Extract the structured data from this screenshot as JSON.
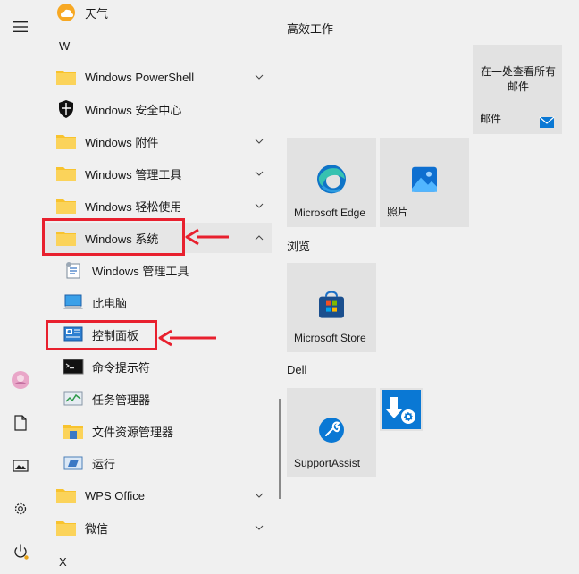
{
  "rail": {
    "menu_icon": "hamburger-menu-icon",
    "avatar": "user-avatar",
    "documents_icon": "document-icon",
    "pictures_icon": "pictures-icon",
    "settings_icon": "gear-icon",
    "power_icon": "power-icon"
  },
  "apps": {
    "weather": "天气",
    "letter_w": "W",
    "powershell": "Windows PowerShell",
    "security": "Windows 安全中心",
    "accessories": "Windows 附件",
    "admin_tools": "Windows 管理工具",
    "ease_access": "Windows 轻松使用",
    "system": "Windows 系统",
    "sys_admin_tools": "Windows 管理工具",
    "this_pc": "此电脑",
    "control_panel": "控制面板",
    "cmd": "命令提示符",
    "task_manager": "任务管理器",
    "explorer": "文件资源管理器",
    "run": "运行",
    "wps": "WPS Office",
    "wechat": "微信",
    "letter_x": "X"
  },
  "tiles": {
    "group_productivity": "高效工作",
    "mail_text": "在一处查看所有邮件",
    "mail_label": "邮件",
    "edge_label": "Microsoft Edge",
    "photos_label": "照片",
    "group_browse": "浏览",
    "store_label": "Microsoft Store",
    "group_dell": "Dell",
    "supportassist_label": "SupportAssist"
  },
  "colors": {
    "highlight_red": "#e8202e",
    "folder_yellow": "#f8c32e",
    "tile_bg": "#e2e2e2",
    "panel_bg": "#f0f0f0"
  }
}
